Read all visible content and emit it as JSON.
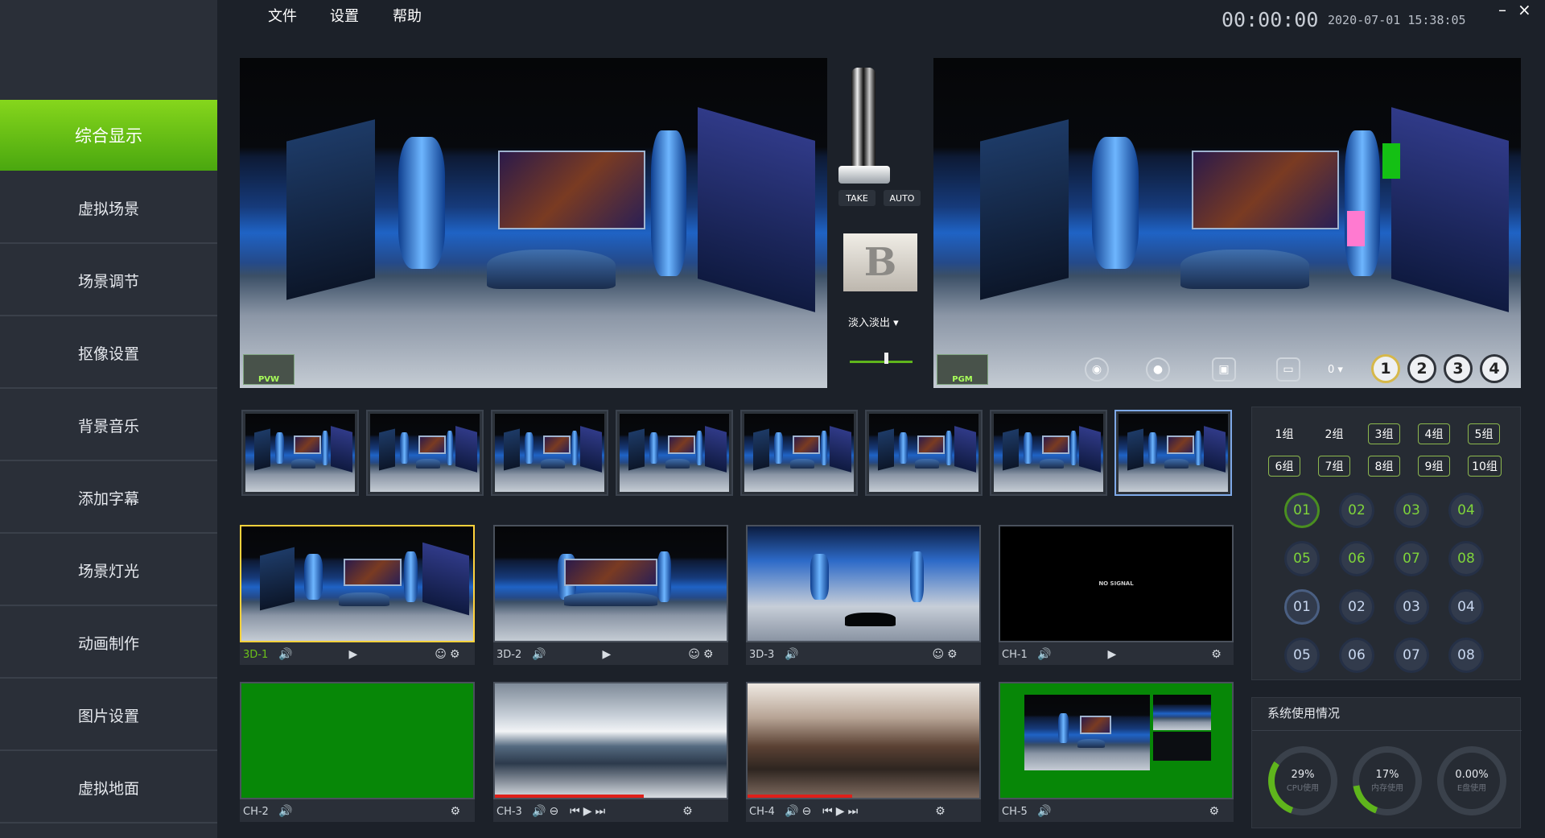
{
  "sidebar": {
    "items": [
      "综合显示",
      "虚拟场景",
      "场景调节",
      "抠像设置",
      "背景音乐",
      "添加字幕",
      "场景灯光",
      "动画制作",
      "图片设置",
      "虚拟地面"
    ]
  },
  "menu": {
    "file": "文件",
    "settings": "设置",
    "help": "帮助"
  },
  "header": {
    "timer": "00:00:00",
    "datetime": "2020-07-01 15:38:05",
    "minimize": "–",
    "close": "×"
  },
  "preview": {
    "tag": "PVW"
  },
  "program": {
    "tag": "PGM",
    "count_select": "0",
    "buttons": [
      "1",
      "2",
      "3",
      "4"
    ]
  },
  "transition": {
    "take": "TAKE",
    "auto": "AUTO",
    "effect": "淡入淡出",
    "logo_letter": "B"
  },
  "sources": [
    {
      "label": "3D-1"
    },
    {
      "label": "3D-2"
    },
    {
      "label": "3D-3"
    },
    {
      "label": "CH-1",
      "overlay": "NO SIGNAL"
    },
    {
      "label": "CH-2"
    },
    {
      "label": "CH-3"
    },
    {
      "label": "CH-4"
    },
    {
      "label": "CH-5"
    }
  ],
  "groups": [
    "1组",
    "2组",
    "3组",
    "4组",
    "5组",
    "6组",
    "7组",
    "8组",
    "9组",
    "10组"
  ],
  "channels_a": [
    "01",
    "02",
    "03",
    "04",
    "05",
    "06",
    "07",
    "08"
  ],
  "channels_b": [
    "01",
    "02",
    "03",
    "04",
    "05",
    "06",
    "07",
    "08"
  ],
  "system": {
    "title": "系统使用情况",
    "cpu": {
      "value": "29%",
      "label": "CPU使用",
      "pct": 29
    },
    "mem": {
      "value": "17%",
      "label": "内存使用",
      "pct": 17
    },
    "disk": {
      "value": "0.00%",
      "label": "E盘使用",
      "pct": 0
    }
  },
  "colors": {
    "accent": "#6bc11a",
    "selected": "#ffd23c",
    "cpu_arc": "#5fb51c"
  }
}
